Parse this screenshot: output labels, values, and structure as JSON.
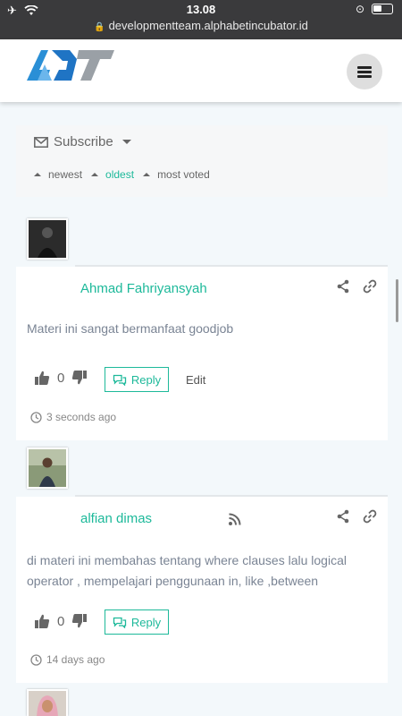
{
  "status": {
    "time": "13.08",
    "url": "developmentteam.alphabetincubator.id"
  },
  "subscribe": {
    "label": "Subscribe"
  },
  "sort": {
    "options": [
      "newest",
      "oldest",
      "most voted"
    ],
    "active": "oldest"
  },
  "comments": [
    {
      "author": "Ahmad Fahriyansyah",
      "text": "Materi ini sangat bermanfaat goodjob",
      "votes": "0",
      "reply": "Reply",
      "edit": "Edit",
      "time": "3 seconds ago"
    },
    {
      "author": "alfian dimas",
      "text": "di materi ini membahas tentang where clauses lalu logical operator , mempelajari penggunaan in, like ,between",
      "votes": "0",
      "reply": "Reply",
      "time": "14 days ago"
    }
  ],
  "colors": {
    "accent": "#1db99a",
    "statusbar": "#3a3a3c"
  },
  "icons": [
    "airplane-icon",
    "wifi-icon",
    "lock-icon",
    "orientation-lock-icon",
    "battery-icon",
    "menu-icon",
    "envelope-icon",
    "share-icon",
    "link-icon",
    "thumbs-up-icon",
    "thumbs-down-icon",
    "reply-icon",
    "clock-icon",
    "feed-icon"
  ]
}
